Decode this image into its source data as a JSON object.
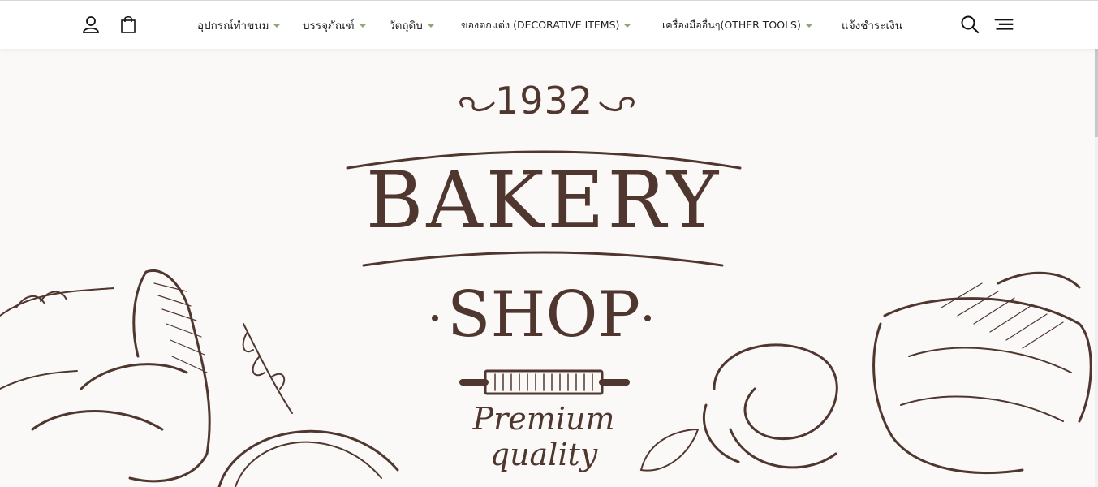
{
  "header": {
    "nav": [
      {
        "label": "อุปกรณ์ทำขนม",
        "has_dropdown": true
      },
      {
        "label": "บรรจุภัณฑ์",
        "has_dropdown": true
      },
      {
        "label": "วัตถุดิบ",
        "has_dropdown": true
      },
      {
        "label": "ของตกแต่ง (DECORATIVE ITEMS)",
        "has_dropdown": true
      },
      {
        "label": "เครื่องมืออื่นๆ(OTHER TOOLS)",
        "has_dropdown": true
      },
      {
        "label": "แจ้งชำระเงิน",
        "has_dropdown": false
      }
    ],
    "icons": {
      "user": "user-icon",
      "cart": "shopping-bag-icon",
      "search": "search-icon",
      "menu": "hamburger-menu-icon"
    },
    "caret_color": "#8dab6e"
  },
  "hero": {
    "year": "1932",
    "title": "BAKERY",
    "subtitle": "SHOP",
    "tagline": "Premium quality",
    "ink_color": "#4f372f",
    "background_color": "#fbf9f8"
  }
}
